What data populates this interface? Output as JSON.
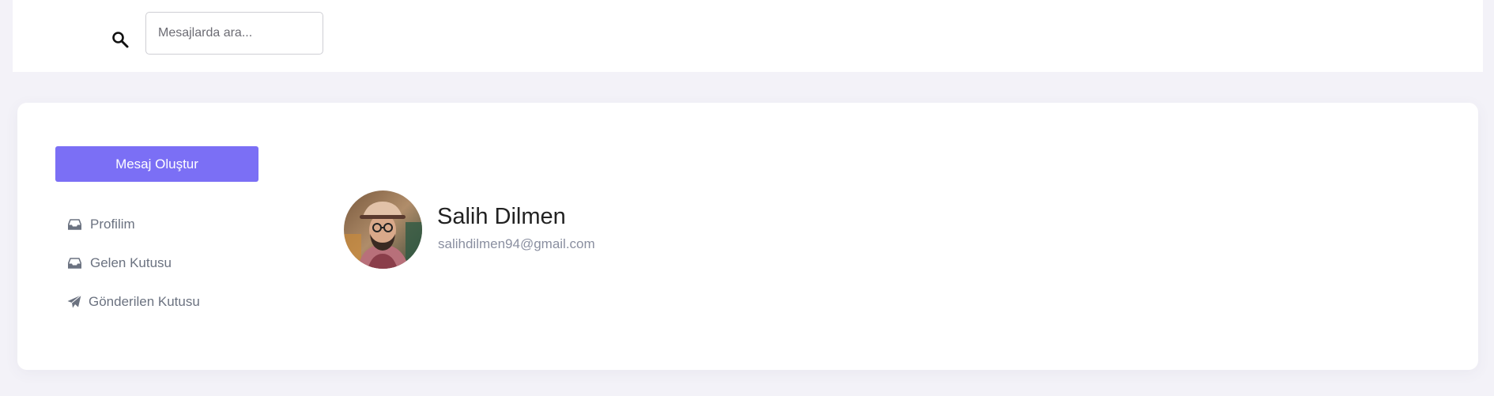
{
  "search": {
    "placeholder": "Mesajlarda ara...",
    "value": "",
    "icon": "search-icon"
  },
  "sidebar": {
    "compose_label": "Mesaj Oluştur",
    "items": [
      {
        "label": "Profilim",
        "icon": "inbox-icon"
      },
      {
        "label": "Gelen Kutusu",
        "icon": "inbox-icon"
      },
      {
        "label": "Gönderilen Kutusu",
        "icon": "paper-plane-icon"
      }
    ]
  },
  "profile": {
    "name": "Salih Dilmen",
    "email": "salihdilmen94@gmail.com"
  },
  "colors": {
    "accent": "#7b6ff5",
    "page_background": "#f3f2f8",
    "nav_text": "#6b7280",
    "email_text": "#8a8fa0"
  }
}
